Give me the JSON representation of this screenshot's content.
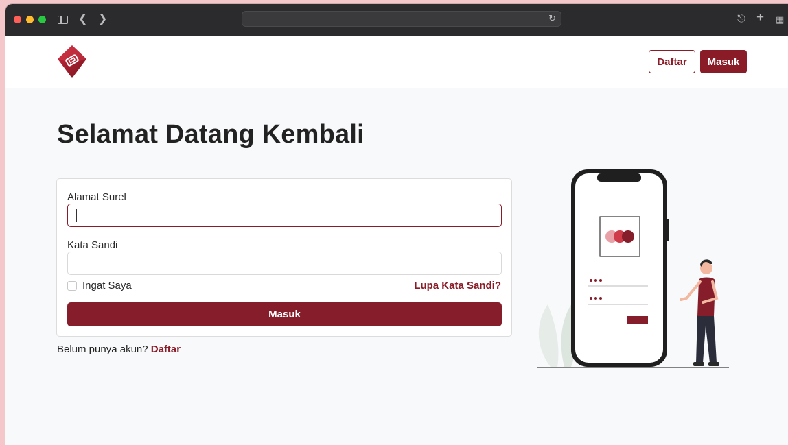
{
  "header": {
    "register_label": "Daftar",
    "login_label": "Masuk"
  },
  "main": {
    "title": "Selamat Datang Kembali",
    "form": {
      "email_label": "Alamat Surel",
      "email_value": "",
      "password_label": "Kata Sandi",
      "password_value": "",
      "remember_label": "Ingat Saya",
      "forgot_label": "Lupa Kata Sandi?",
      "submit_label": "Masuk"
    },
    "register_prompt": "Belum punya akun?",
    "register_link": "Daftar"
  },
  "colors": {
    "brand": "#861d2a",
    "background": "#f8f9fa"
  },
  "icons": [
    "sidebar-icon",
    "back-icon",
    "forward-icon",
    "reload-icon",
    "share-icon",
    "plus-icon",
    "tabs-icon",
    "logo-icon"
  ]
}
